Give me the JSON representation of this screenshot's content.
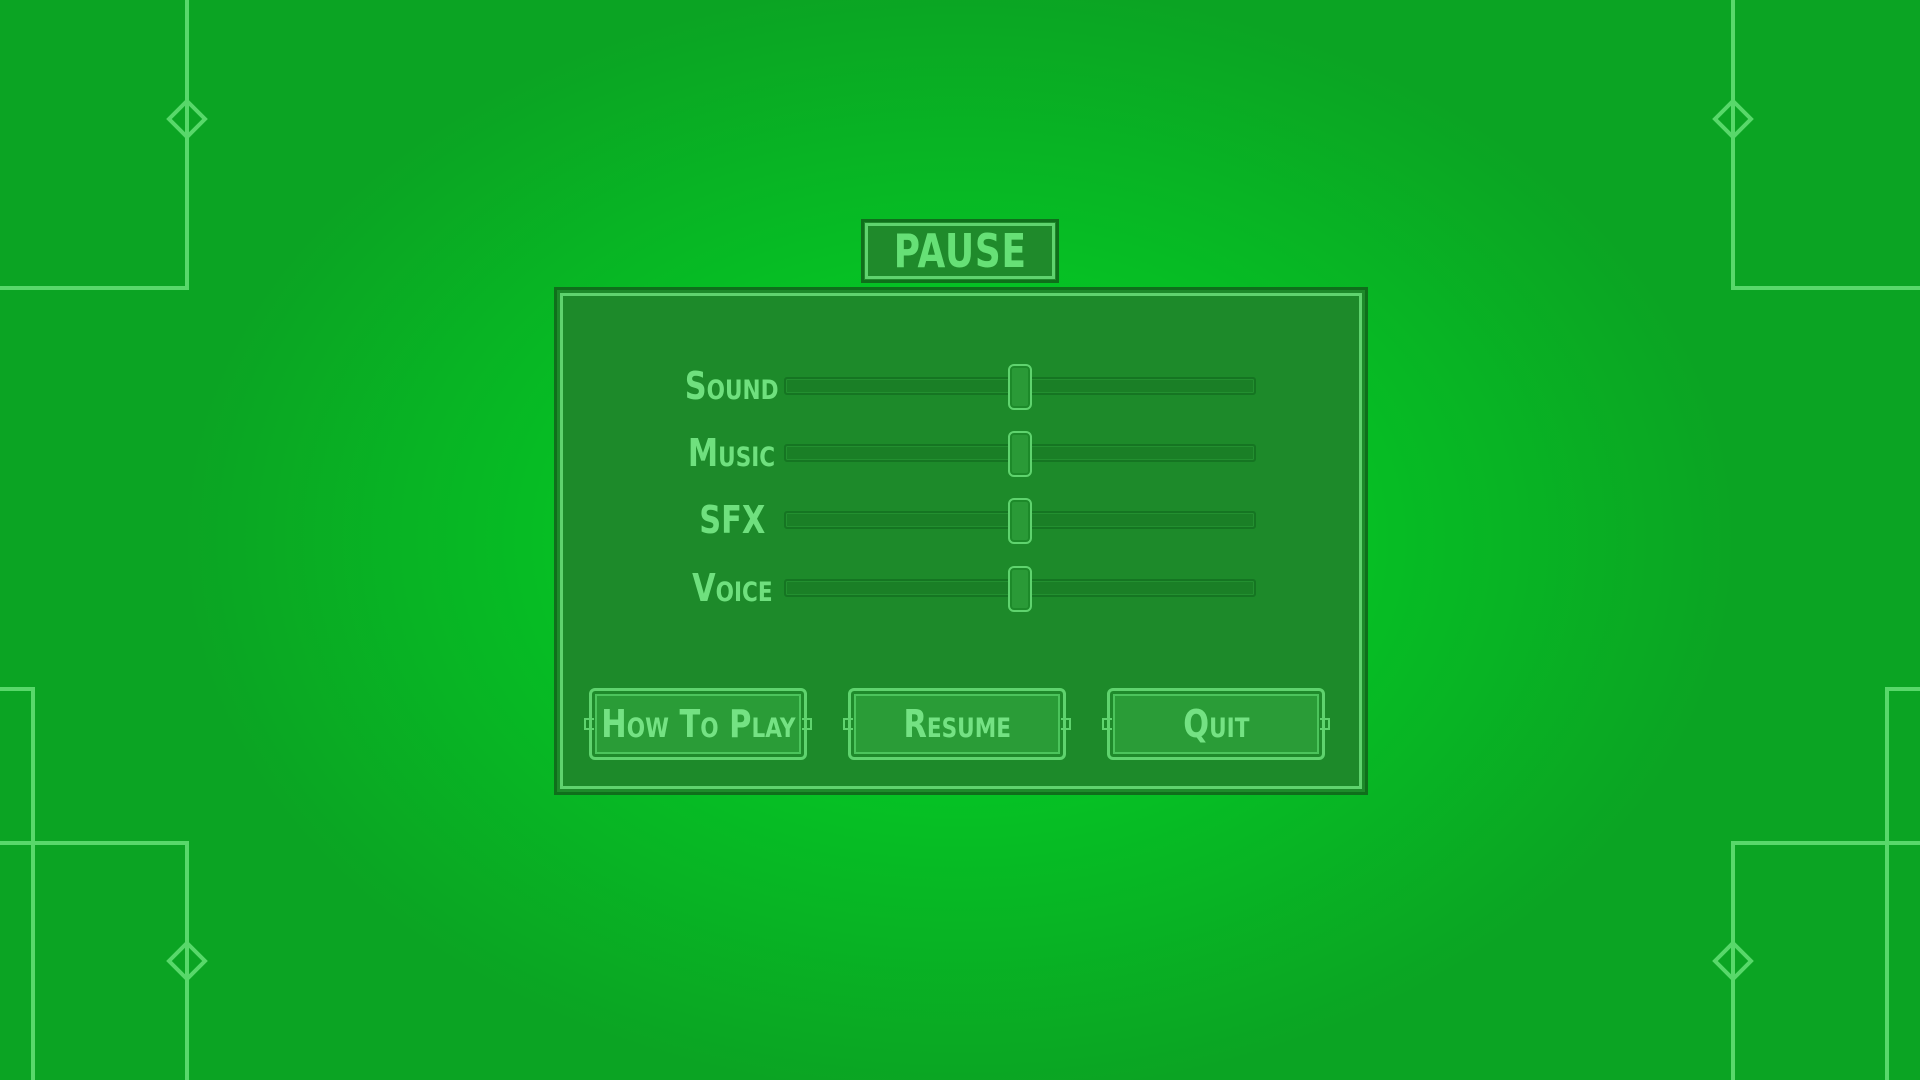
{
  "screen": {
    "title": "PAUSE"
  },
  "colors": {
    "background_center": "#00dc2a",
    "background_edge": "#0ba423",
    "panel": "#1d8a2a",
    "accent": "#5fd36e",
    "text": "#6fe07e"
  },
  "sliders": [
    {
      "label": "Sound",
      "value_fraction": 0.5
    },
    {
      "label": "Music",
      "value_fraction": 0.5
    },
    {
      "label": "SFX",
      "value_fraction": 0.5
    },
    {
      "label": "Voice",
      "value_fraction": 0.5
    }
  ],
  "buttons": {
    "how_to_play": "How To Play",
    "resume": "Resume",
    "quit": "Quit"
  }
}
